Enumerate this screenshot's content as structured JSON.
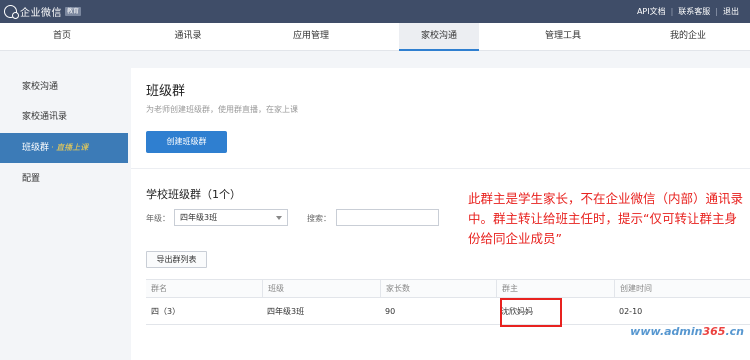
{
  "topbar": {
    "logo_text": "企业微信",
    "logo_badge": "教育",
    "links": [
      "API文档",
      "联系客服",
      "退出"
    ]
  },
  "nav": {
    "items": [
      "首页",
      "通讯录",
      "应用管理",
      "家校沟通",
      "管理工具",
      "我的企业"
    ],
    "active_index": 3
  },
  "sidebar": {
    "items": [
      {
        "label": "家校沟通"
      },
      {
        "label": "家校通讯录"
      },
      {
        "label": "班级群",
        "suffix": "· 直播上课"
      },
      {
        "label": "配置"
      }
    ],
    "active_index": 2
  },
  "main": {
    "title": "班级群",
    "description": "为老师创建班级群，使用群直播，在家上课",
    "create_button": "创建班级群",
    "section_title": "学校班级群（1个）",
    "filter": {
      "grade_label": "年级：",
      "grade_value": "四年级3班",
      "search_label": "搜索：",
      "search_value": ""
    },
    "export_button": "导出群列表",
    "table": {
      "headers": [
        "群名",
        "班级",
        "家长数",
        "群主",
        "创建时间"
      ],
      "rows": [
        [
          "四（3）",
          "四年级3班",
          "90",
          "沈欣妈妈",
          "02-10"
        ]
      ]
    }
  },
  "annotation": {
    "text": "此群主是学生家长，不在企业微信（内部）通讯录中。群主转让给班主任时，提示“仅可转让群主身份给同企业成员”",
    "color": "#e8221f"
  },
  "watermark": {
    "prefix": "www.admin",
    "number": "365",
    "suffix": ".cn"
  },
  "colors": {
    "topbar": "#3f4d68",
    "primary": "#2f7fd0",
    "sidebar_active": "#3c7bb7"
  }
}
